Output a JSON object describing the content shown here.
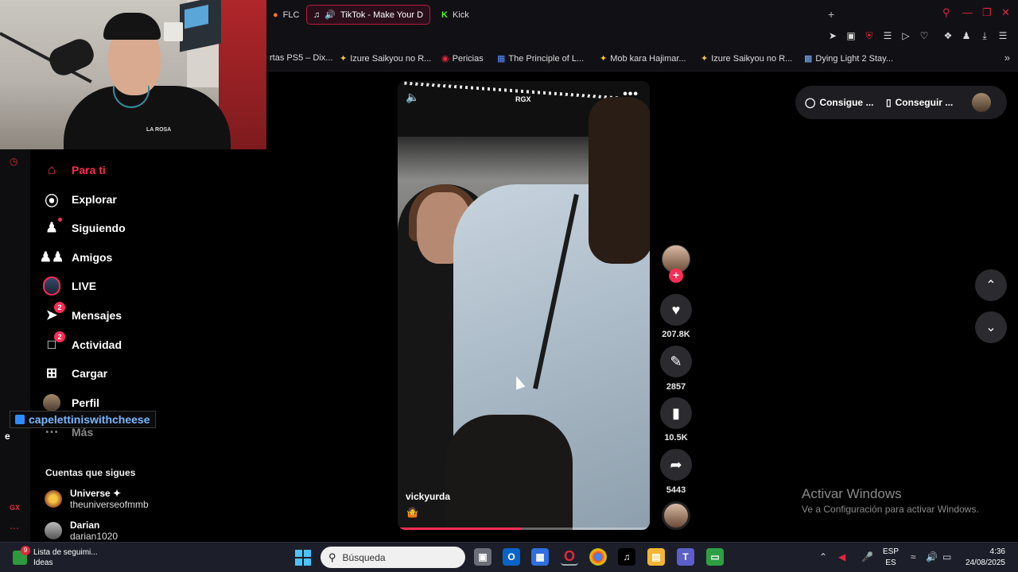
{
  "browser": {
    "tabs": [
      {
        "label": "FLC",
        "icon": "fire-icon"
      },
      {
        "label": "TikTok - Make Your D",
        "icon": "tiktok-icon",
        "active": true
      },
      {
        "label": "Kick",
        "icon": "kick-icon"
      }
    ],
    "new_tab": "+",
    "bookmarks": [
      {
        "label": "rtas PS5 – Dix..."
      },
      {
        "label": "Izure Saikyou no R..."
      },
      {
        "label": "Pericias"
      },
      {
        "label": "The Principle of L..."
      },
      {
        "label": "Mob kara Hajimar..."
      },
      {
        "label": "Izure Saikyou no R..."
      },
      {
        "label": "Dying Light 2 Stay..."
      }
    ]
  },
  "sidebar": {
    "nav": [
      {
        "label": "Para ti",
        "icon": "home-icon",
        "active": true
      },
      {
        "label": "Explorar",
        "icon": "compass-icon"
      },
      {
        "label": "Siguiendo",
        "icon": "user-follow-icon"
      },
      {
        "label": "Amigos",
        "icon": "friends-icon"
      },
      {
        "label": "LIVE",
        "icon": "live-icon"
      },
      {
        "label": "Mensajes",
        "icon": "send-icon",
        "badge": "2"
      },
      {
        "label": "Actividad",
        "icon": "activity-icon",
        "badge": "2"
      },
      {
        "label": "Cargar",
        "icon": "upload-icon"
      },
      {
        "label": "Perfil",
        "icon": "profile-icon"
      },
      {
        "label": "Más",
        "icon": "more-icon"
      }
    ],
    "following_title": "Cuentas que sigues",
    "following": [
      {
        "name": "Universe ✦",
        "handle": "theuniverseofmmb"
      },
      {
        "name": "Darian",
        "handle": "darian1020"
      }
    ],
    "rail_label": "GX"
  },
  "stream_overlay": {
    "username": "capelettiniswithcheese",
    "letter": "e"
  },
  "webcam": {
    "shirt_print": "LA ROSA"
  },
  "video": {
    "watermark": "RGX",
    "author": "vickyurda",
    "emoji": "🤷",
    "progress": 0.49
  },
  "actions": {
    "likes": "207.8K",
    "comments": "2857",
    "saves": "10.5K",
    "shares": "5443"
  },
  "promo": {
    "item1": "Consigue ...",
    "item2": "Conseguir ..."
  },
  "windows_activation": {
    "title": "Activar Windows",
    "subtitle": "Ve a Configuración para activar Windows."
  },
  "taskbar": {
    "widget_badge": "9",
    "widget_line1": "Lista de seguimi...",
    "widget_line2": "Ideas",
    "search_placeholder": "Búsqueda",
    "lang_line1": "ESP",
    "lang_line2": "ES",
    "time": "4:36",
    "date": "24/08/2025"
  },
  "colors": {
    "accent": "#fe2c55",
    "browser_accent": "#e0283e",
    "background": "#000000"
  }
}
